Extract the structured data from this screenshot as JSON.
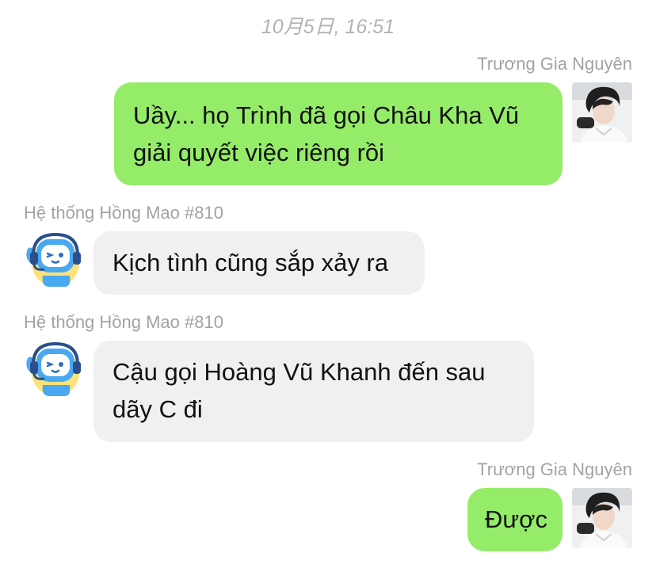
{
  "conversation": {
    "timestamp": "10月5日, 16:51",
    "messages": [
      {
        "sender": "Trương Gia Nguyên",
        "side": "right",
        "lines": [
          "Uầy... họ Trình đã gọi Châu Kha Vũ",
          "giải quyết việc riêng rồi"
        ],
        "avatar": "boy-portrait-avatar"
      },
      {
        "sender": "Hệ thống Hồng Mao #810",
        "side": "left",
        "lines": [
          "Kịch tình cũng sắp xảy ra"
        ],
        "avatar": "robot-headset-avatar"
      },
      {
        "sender": "Hệ thống Hồng Mao #810",
        "side": "left",
        "lines": [
          "Cậu gọi Hoàng Vũ Khanh đến sau",
          "dãy C đi"
        ],
        "avatar": "robot-headset-avatar"
      },
      {
        "sender": "Trương Gia Nguyên",
        "side": "right",
        "lines": [
          "Được"
        ],
        "avatar": "boy-portrait-avatar"
      }
    ]
  },
  "colors": {
    "outgoing_bubble": "#95ec69",
    "incoming_bubble": "#f0f0f0",
    "meta_text": "#a3a3a3",
    "robot_body": "#4aa8f0",
    "robot_backdrop": "#fde27a"
  }
}
